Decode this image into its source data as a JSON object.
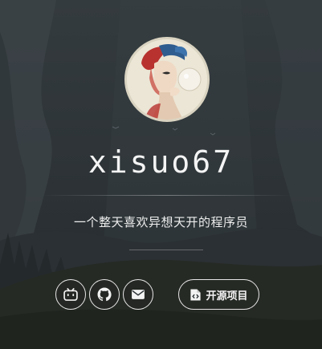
{
  "profile": {
    "name": "xisuo67",
    "tagline": "一个整天喜欢异想天开的程序员"
  },
  "links": {
    "bilibili_icon": "bilibili-icon",
    "github_icon": "github-icon",
    "mail_icon": "mail-icon",
    "projects_label": "开源项目",
    "projects_icon": "file-code-icon"
  },
  "colors": {
    "background": "#2a2f33",
    "text": "#f2f2f2",
    "avatar_border": "#d9d3c1"
  }
}
